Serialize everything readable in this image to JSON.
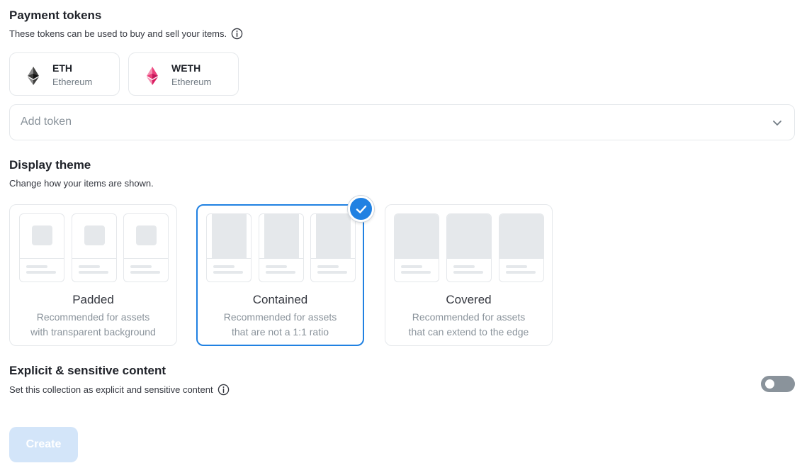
{
  "payment_tokens": {
    "title": "Payment tokens",
    "description": "These tokens can be used to buy and sell your items.",
    "tokens": [
      {
        "symbol": "ETH",
        "network": "Ethereum",
        "icon": "eth-icon"
      },
      {
        "symbol": "WETH",
        "network": "Ethereum",
        "icon": "weth-icon"
      }
    ],
    "add_token_placeholder": "Add token"
  },
  "display_theme": {
    "title": "Display theme",
    "description": "Change how your items are shown.",
    "options": [
      {
        "name": "Padded",
        "desc_line1": "Recommended for assets",
        "desc_line2": "with transparent background",
        "selected": false
      },
      {
        "name": "Contained",
        "desc_line1": "Recommended for assets",
        "desc_line2": "that are not a 1:1 ratio",
        "selected": true
      },
      {
        "name": "Covered",
        "desc_line1": "Recommended for assets",
        "desc_line2": "that can extend to the edge",
        "selected": false
      }
    ]
  },
  "explicit": {
    "title": "Explicit & sensitive content",
    "description": "Set this collection as explicit and sensitive content",
    "enabled": false
  },
  "create_button": {
    "label": "Create",
    "disabled": true
  },
  "colors": {
    "accent": "#2081e2",
    "border": "#e5e8eb",
    "muted_text": "#8a939b",
    "weth_pink": "#ec407a",
    "disabled_button": "#d3e5f9"
  }
}
